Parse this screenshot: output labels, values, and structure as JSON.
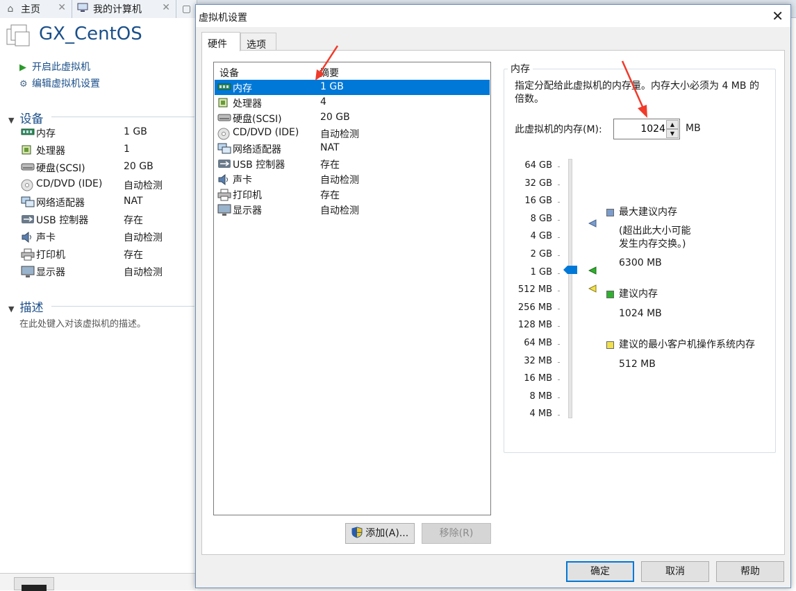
{
  "app_tabs": [
    {
      "label": "主页",
      "icon": "home-icon"
    },
    {
      "label": "我的计算机",
      "icon": "computer-icon"
    },
    {
      "label": "",
      "icon": "vm-icon"
    }
  ],
  "vm": {
    "name": "GX_CentOS",
    "actions": {
      "power_on": "开启此虚拟机",
      "edit_settings": "编辑虚拟机设置"
    },
    "devices_heading": "设备",
    "devices": [
      {
        "name": "内存",
        "value": "1 GB",
        "icon": "memory-icon"
      },
      {
        "name": "处理器",
        "value": "1",
        "icon": "cpu-icon"
      },
      {
        "name": "硬盘(SCSI)",
        "value": "20 GB",
        "icon": "hdd-icon"
      },
      {
        "name": "CD/DVD (IDE)",
        "value": "自动检测",
        "icon": "cd-icon"
      },
      {
        "name": "网络适配器",
        "value": "NAT",
        "icon": "network-icon"
      },
      {
        "name": "USB 控制器",
        "value": "存在",
        "icon": "usb-icon"
      },
      {
        "name": "声卡",
        "value": "自动检测",
        "icon": "sound-icon"
      },
      {
        "name": "打印机",
        "value": "存在",
        "icon": "printer-icon"
      },
      {
        "name": "显示器",
        "value": "自动检测",
        "icon": "display-icon"
      }
    ],
    "desc_heading": "描述",
    "desc_placeholder": "在此处键入对该虚拟机的描述。"
  },
  "dialog": {
    "title": "虚拟机设置",
    "tabs": [
      "硬件",
      "选项"
    ],
    "list_headers": {
      "device": "设备",
      "summary": "摘要"
    },
    "devices": [
      {
        "name": "内存",
        "value": "1 GB",
        "icon": "memory-icon"
      },
      {
        "name": "处理器",
        "value": "4",
        "icon": "cpu-icon"
      },
      {
        "name": "硬盘(SCSI)",
        "value": "20 GB",
        "icon": "hdd-icon"
      },
      {
        "name": "CD/DVD (IDE)",
        "value": "自动检测",
        "icon": "cd-icon"
      },
      {
        "name": "网络适配器",
        "value": "NAT",
        "icon": "network-icon"
      },
      {
        "name": "USB 控制器",
        "value": "存在",
        "icon": "usb-icon"
      },
      {
        "name": "声卡",
        "value": "自动检测",
        "icon": "sound-icon"
      },
      {
        "name": "打印机",
        "value": "存在",
        "icon": "printer-icon"
      },
      {
        "name": "显示器",
        "value": "自动检测",
        "icon": "display-icon"
      }
    ],
    "selected_index": 0,
    "add_button": "添加(A)...",
    "remove_button": "移除(R)",
    "memory": {
      "group_title": "内存",
      "description": "指定分配给此虚拟机的内存量。内存大小必须为 4 MB 的倍数。",
      "field_label": "此虚拟机的内存(M):",
      "value": "1024",
      "unit": "MB",
      "scale_labels": [
        "64 GB",
        "32 GB",
        "16 GB",
        "8 GB",
        "4 GB",
        "2 GB",
        "1 GB",
        "512 MB",
        "256 MB",
        "128 MB",
        "64 MB",
        "32 MB",
        "16 MB",
        "8 MB",
        "4 MB"
      ],
      "current_level": "1 GB",
      "legend": [
        {
          "title": "最大建议内存",
          "note": "(超出此大小可能\n发生内存交换。)",
          "value": "6300 MB",
          "color": "#7b9ccc"
        },
        {
          "title": "建议内存",
          "value": "1024 MB",
          "color": "#2fb02f"
        },
        {
          "title": "建议的最小客户机操作系统内存",
          "value": "512 MB",
          "color": "#f0e050"
        }
      ]
    },
    "buttons": {
      "ok": "确定",
      "cancel": "取消",
      "help": "帮助"
    }
  },
  "colors": {
    "accent": "#0078d7",
    "annotation_arrow": "#f03a2a",
    "title_blue": "#1a4f8a"
  }
}
